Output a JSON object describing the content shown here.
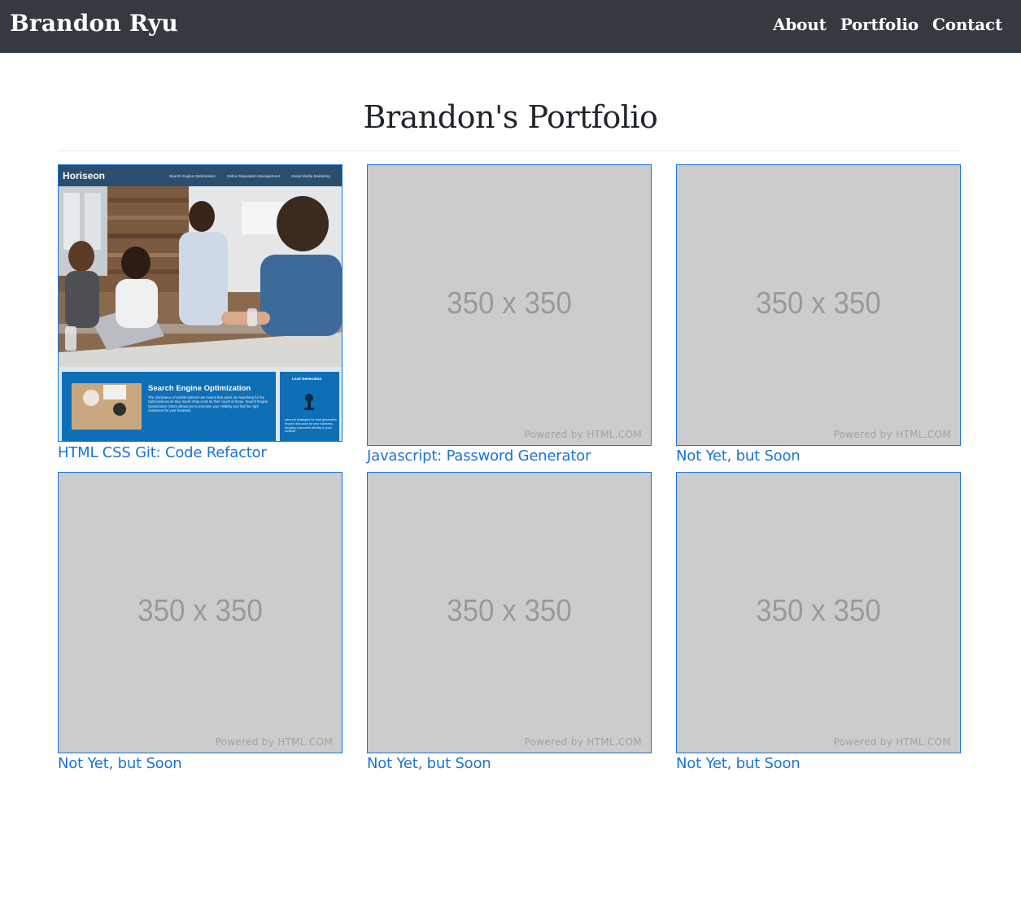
{
  "navbar": {
    "brand": "Brandon Ryu",
    "links": [
      "About",
      "Portfolio",
      "Contact"
    ]
  },
  "page": {
    "title": "Brandon's Portfolio"
  },
  "projects": [
    {
      "label": "HTML CSS Git: Code Refactor",
      "thumbnail": {
        "logo": "Horiseon",
        "nav": [
          "Search Engine Optimization",
          "Online Reputation Management",
          "Social Media Marketing"
        ],
        "section_title": "Search Engine Optimization",
        "section_text": "The dominance of mobile internet use means that users are searching for the right business as they travel, shop or sit on their couch at home. Search Engine Optimization (SEO) allows you to increase your visibility and find the right customers for your business.",
        "aside_title": "Lead Generation",
        "aside_text": "Inbound strategies for lead generation require less work for your business, bringing customers directly to your website."
      }
    },
    {
      "label": "Javascript: Password Generator",
      "placeholder": "350 x 350",
      "powered": "Powered by HTML.COM"
    },
    {
      "label": "Not Yet, but Soon",
      "placeholder": "350 x 350",
      "powered": "Powered by HTML.COM"
    },
    {
      "label": "Not Yet, but Soon",
      "placeholder": "350 x 350",
      "powered": "Powered by HTML.COM"
    },
    {
      "label": "Not Yet, but Soon",
      "placeholder": "350 x 350",
      "powered": "Powered by HTML.COM"
    },
    {
      "label": "Not Yet, but Soon",
      "placeholder": "350 x 350",
      "powered": "Powered by HTML.COM"
    }
  ],
  "colors": {
    "navbar_bg": "#343a40",
    "link": "#1a73d9",
    "placeholder_bg": "#cccccc",
    "placeholder_text": "#9a9a9a",
    "thumb_header": "#2a4f6e",
    "thumb_blue": "#0f6fb6"
  }
}
